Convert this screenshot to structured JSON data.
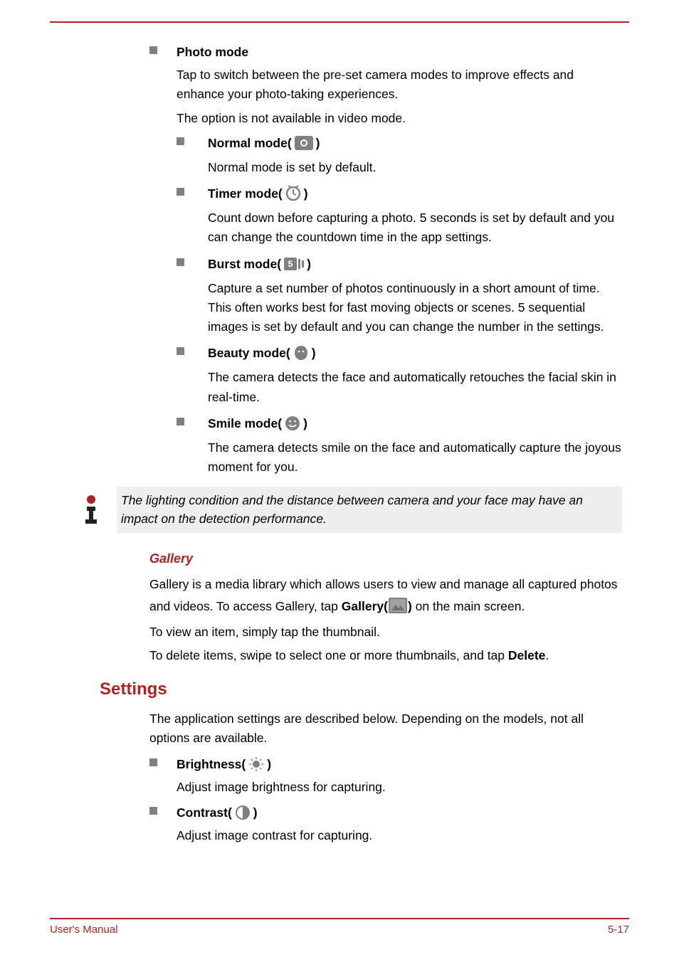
{
  "sections": {
    "photo_mode": {
      "title": "Photo mode",
      "p1": "Tap to switch between the pre-set camera modes to improve effects and enhance your photo-taking experiences.",
      "p2": "The option is not available in video mode.",
      "modes": {
        "normal": {
          "label_pre": "Normal mode(",
          "label_post": ")",
          "desc": "Normal mode is set by default."
        },
        "timer": {
          "label_pre": "Timer mode(",
          "label_post": ")",
          "desc": "Count down before capturing a photo. 5 seconds is set by default and you can change the countdown time in the app settings."
        },
        "burst": {
          "label_pre": "Burst mode(",
          "label_post": ")",
          "desc": "Capture a set number of photos continuously in a short amount of time. This often works best for fast moving objects or scenes. 5 sequential images is set by default and you can change the number in the settings."
        },
        "beauty": {
          "label_pre": "Beauty mode(",
          "label_post": ")",
          "desc": "The camera detects the face and automatically retouches the facial skin in real-time."
        },
        "smile": {
          "label_pre": "Smile mode(",
          "label_post": ")",
          "desc": "The camera detects smile on the face and automatically capture the joyous moment for you."
        }
      }
    },
    "note": "The lighting condition and the distance between camera and your face may have an impact on the detection performance.",
    "gallery": {
      "heading": "Gallery",
      "p1_pre": "Gallery is a media library which allows users to view and manage all captured photos and videos. To access Gallery, tap ",
      "p1_bold": "Gallery(",
      "p1_bold_post": ")",
      "p1_post": " on the main screen.",
      "p2": "To view an item, simply tap the thumbnail.",
      "p3_pre": "To delete items, swipe to select one or more thumbnails, and tap ",
      "p3_bold": "Delete",
      "p3_post": "."
    },
    "settings": {
      "heading": "Settings",
      "intro": "The application settings are described below. Depending on the models, not all options are available.",
      "brightness": {
        "label_pre": "Brightness(",
        "label_post": ")",
        "desc": "Adjust image brightness for capturing."
      },
      "contrast": {
        "label_pre": "Contrast(",
        "label_post": ")",
        "desc": "Adjust image contrast for capturing."
      }
    }
  },
  "footer": {
    "left": "User's Manual",
    "right": "5-17"
  }
}
